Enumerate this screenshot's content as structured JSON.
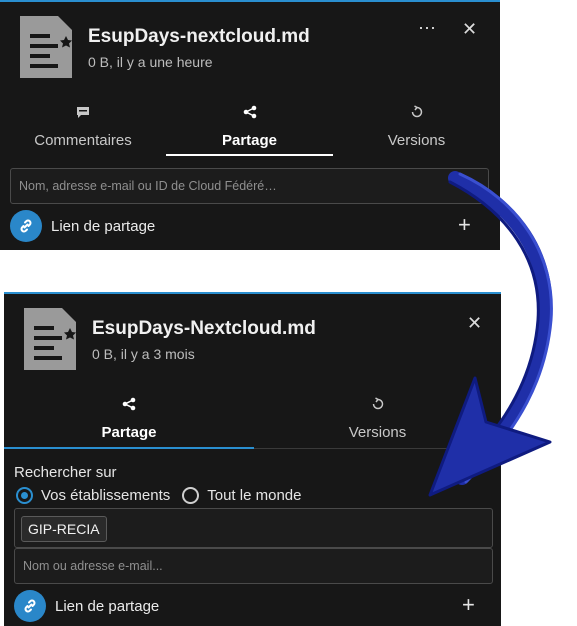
{
  "top_panel": {
    "file_icon": "markdown-file-icon",
    "title": "EsupDays-nextcloud.md",
    "subtitle": "0 B, il y a une heure",
    "menu_icon": "more-icon",
    "close_icon": "close-icon",
    "tabs": [
      {
        "label": "Commentaires",
        "icon": "comment-icon"
      },
      {
        "label": "Partage",
        "icon": "share-icon"
      },
      {
        "label": "Versions",
        "icon": "history-icon"
      }
    ],
    "search_placeholder": "Nom, adresse e-mail ou ID de Cloud Fédéré…",
    "share_link_label": "Lien de partage",
    "add_icon": "plus-icon"
  },
  "bottom_panel": {
    "file_icon": "markdown-file-icon",
    "title": "EsupDays-Nextcloud.md",
    "subtitle": "0 B, il y a 3 mois",
    "close_icon": "close-icon",
    "tabs": [
      {
        "label": "Partage",
        "icon": "share-icon"
      },
      {
        "label": "Versions",
        "icon": "history-icon"
      }
    ],
    "search_on_label": "Rechercher sur",
    "radio_options": [
      {
        "label": "Vos établissements",
        "checked": true
      },
      {
        "label": "Tout le monde",
        "checked": false
      }
    ],
    "selected_chip": "GIP-RECIA",
    "search_placeholder": "Nom ou adresse e-mail...",
    "share_link_label": "Lien de partage",
    "add_icon": "plus-icon"
  },
  "colors": {
    "panel_bg": "#171717",
    "accent": "#2a8fd0",
    "arrow": "#1f2fa8"
  }
}
